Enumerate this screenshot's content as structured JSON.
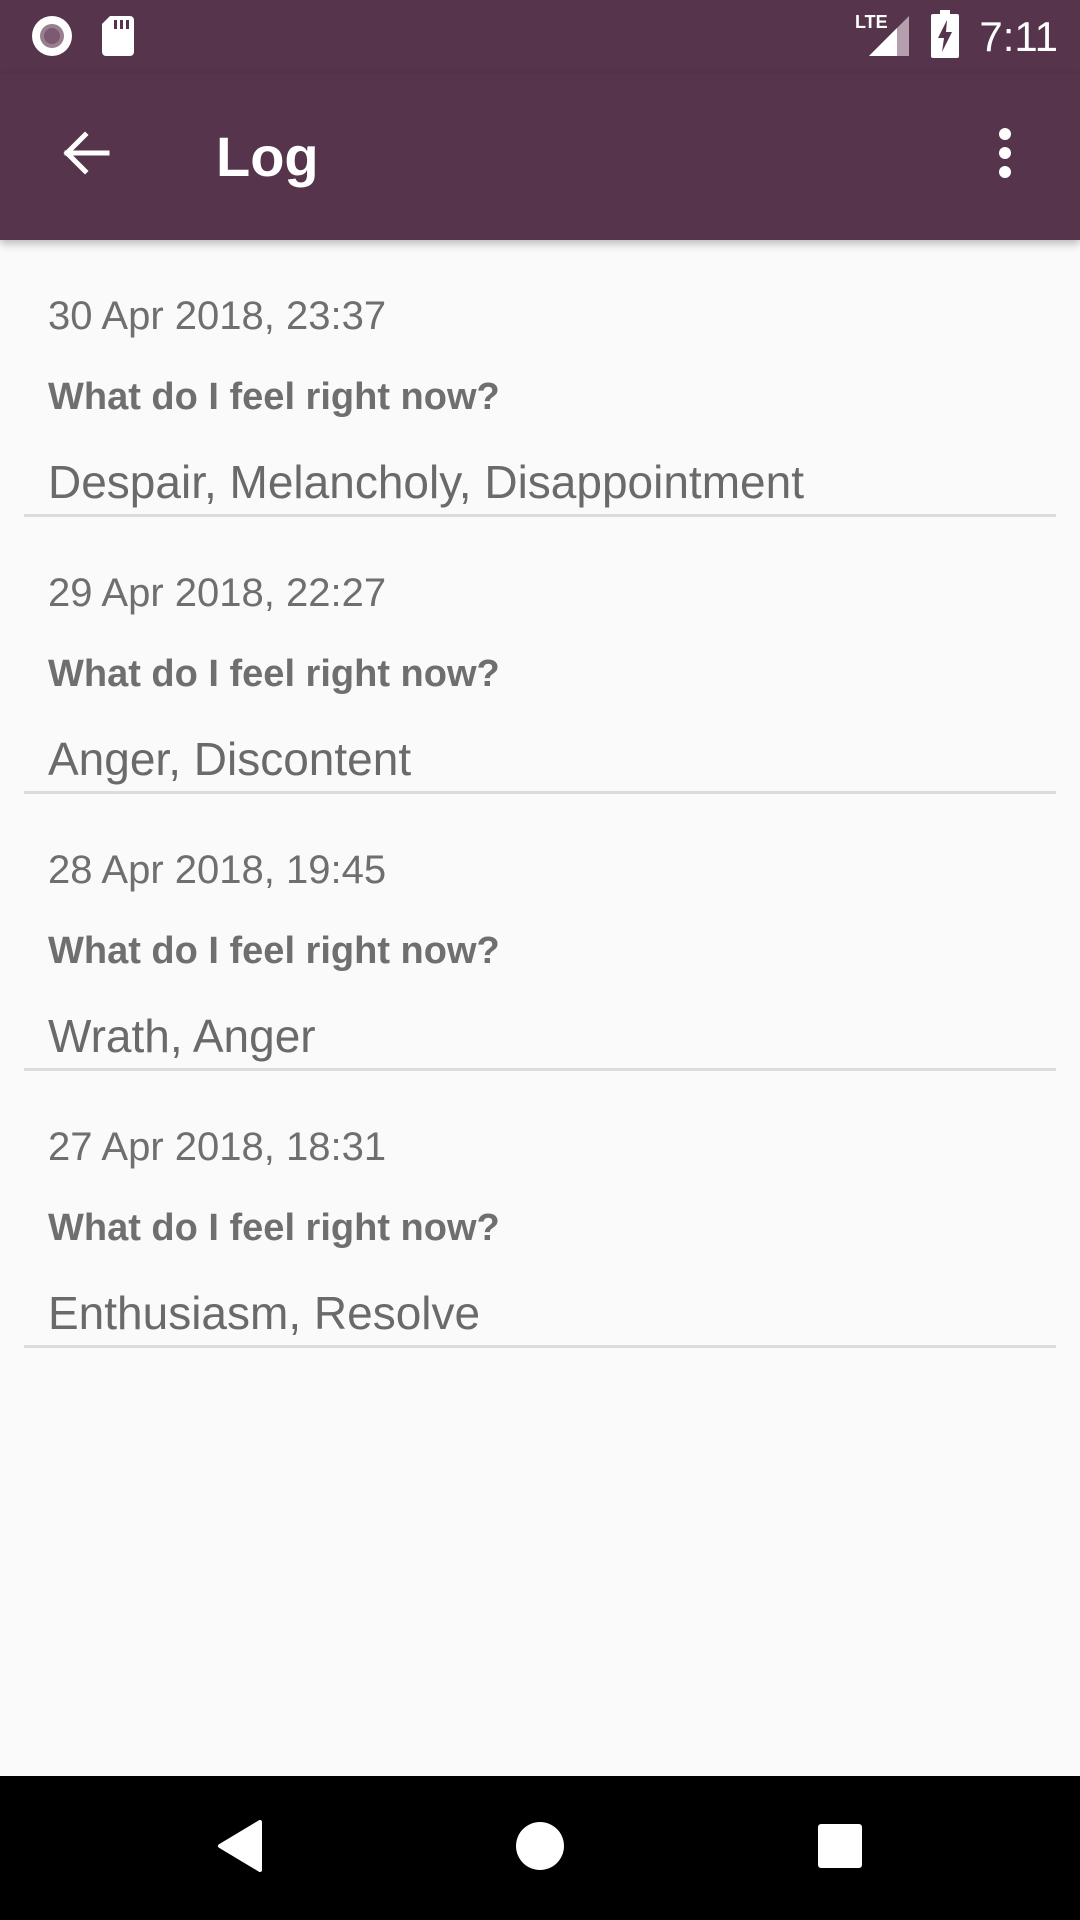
{
  "status_bar": {
    "time": "7:11",
    "network": "LTE",
    "icons": [
      "record-icon",
      "sd-card-icon",
      "signal-icon",
      "battery-charging-icon"
    ]
  },
  "app_bar": {
    "title": "Log",
    "background_color": "#56344b",
    "back_icon": "arrow-back-icon",
    "menu_icon": "more-vert-icon"
  },
  "entries": [
    {
      "date": "30 Apr 2018, 23:37",
      "question": "What do I feel right now?",
      "answer": "Despair, Melancholy, Disappointment"
    },
    {
      "date": "29 Apr 2018, 22:27",
      "question": "What do I feel right now?",
      "answer": "Anger, Discontent"
    },
    {
      "date": "28 Apr 2018, 19:45",
      "question": "What do I feel right now?",
      "answer": "Wrath, Anger"
    },
    {
      "date": "27 Apr 2018, 18:31",
      "question": "What do I feel right now?",
      "answer": "Enthusiasm, Resolve"
    }
  ],
  "nav_bar": {
    "buttons": [
      "back-triangle-icon",
      "home-circle-icon",
      "recents-square-icon"
    ]
  }
}
